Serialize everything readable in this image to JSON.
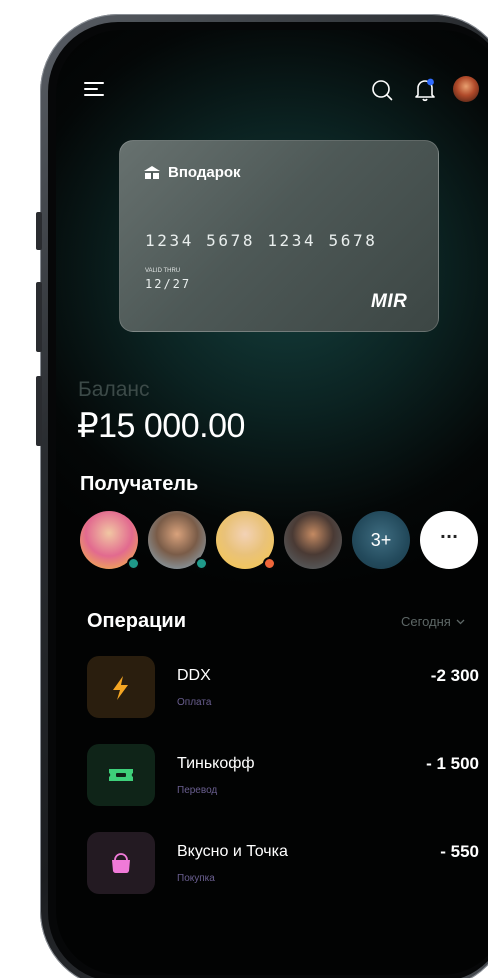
{
  "card": {
    "brand": "Вподарок",
    "number": "1234 5678 1234 5678",
    "valid_label": "VALID THRU",
    "valid": "12/27",
    "logo": "MIR"
  },
  "balance": {
    "label": "Баланс",
    "amount": "₽15 000.00"
  },
  "recipients": {
    "title": "Получатель",
    "more_count": "3+",
    "more_label": "···",
    "items": [
      {
        "name": "recipient-1",
        "status_color": "#1f9a8a"
      },
      {
        "name": "recipient-2",
        "status_color": "#1f9a8a"
      },
      {
        "name": "recipient-3",
        "status_color": "#f0663a"
      },
      {
        "name": "recipient-4"
      },
      {
        "name": "recipient-5"
      }
    ]
  },
  "operations": {
    "title": "Операции",
    "filter": "Сегодня",
    "items": [
      {
        "name": "DDX",
        "type": "Оплата",
        "amount": "-2 300",
        "icon": "lightning-icon",
        "icon_color": "#f5a623",
        "bg": "#2a1e0e"
      },
      {
        "name": "Тинькофф",
        "type": "Перевод",
        "amount": "- 1 500",
        "icon": "ticket-icon",
        "icon_color": "#3ed07a",
        "bg": "#0f2418"
      },
      {
        "name": "Вкусно и Точка",
        "type": "Покупка",
        "amount": "- 550",
        "icon": "bag-icon",
        "icon_color": "#f07ad8",
        "bg": "#231a22"
      }
    ]
  },
  "colors": {
    "accent_teal": "#15403e",
    "notification_dot": "#2f6bff"
  }
}
